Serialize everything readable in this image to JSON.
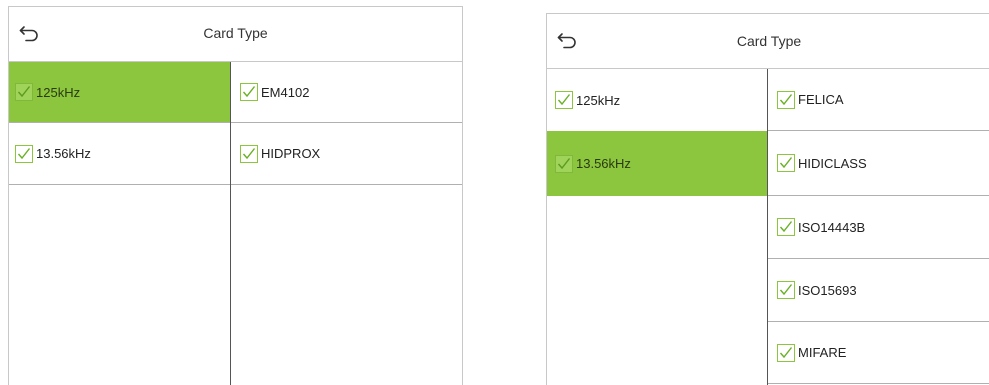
{
  "left_screen": {
    "title": "Card Type",
    "frequencies": [
      {
        "label": "125kHz",
        "selected": true,
        "checked": true
      },
      {
        "label": "13.56kHz",
        "selected": false,
        "checked": true
      }
    ],
    "card_types": [
      {
        "label": "EM4102",
        "checked": true
      },
      {
        "label": "HIDPROX",
        "checked": true
      }
    ]
  },
  "right_screen": {
    "title": "Card Type",
    "frequencies": [
      {
        "label": "125kHz",
        "selected": false,
        "checked": true
      },
      {
        "label": "13.56kHz",
        "selected": true,
        "checked": true
      }
    ],
    "card_types": [
      {
        "label": "FELICA",
        "checked": true
      },
      {
        "label": "HIDICLASS",
        "checked": true
      },
      {
        "label": "ISO14443B",
        "checked": true
      },
      {
        "label": "ISO15693",
        "checked": true
      },
      {
        "label": "MIFARE",
        "checked": true
      }
    ]
  },
  "colors": {
    "selected_row": "#8cc63f",
    "checkbox_border": "#8cc63f",
    "checkmark": "#6ab023"
  },
  "icons": {
    "back": "back-arrow-icon",
    "check": "checkbox-checked-icon"
  }
}
